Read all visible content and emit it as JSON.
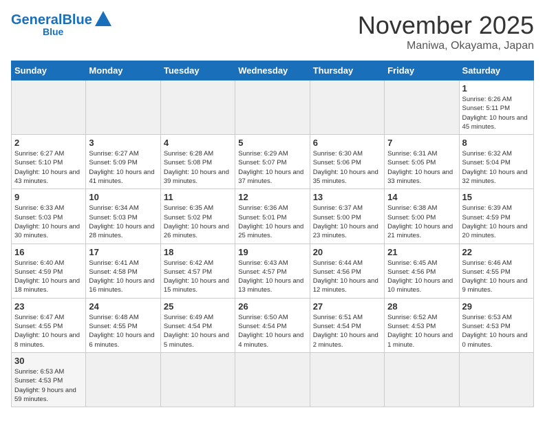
{
  "header": {
    "logo_general": "General",
    "logo_blue": "Blue",
    "month_title": "November 2025",
    "location": "Maniwa, Okayama, Japan"
  },
  "days_of_week": [
    "Sunday",
    "Monday",
    "Tuesday",
    "Wednesday",
    "Thursday",
    "Friday",
    "Saturday"
  ],
  "weeks": [
    [
      {
        "day": "",
        "info": "",
        "empty": true
      },
      {
        "day": "",
        "info": "",
        "empty": true
      },
      {
        "day": "",
        "info": "",
        "empty": true
      },
      {
        "day": "",
        "info": "",
        "empty": true
      },
      {
        "day": "",
        "info": "",
        "empty": true
      },
      {
        "day": "",
        "info": "",
        "empty": true
      },
      {
        "day": "1",
        "info": "Sunrise: 6:26 AM\nSunset: 5:11 PM\nDaylight: 10 hours and 45 minutes."
      }
    ],
    [
      {
        "day": "2",
        "info": "Sunrise: 6:27 AM\nSunset: 5:10 PM\nDaylight: 10 hours and 43 minutes."
      },
      {
        "day": "3",
        "info": "Sunrise: 6:27 AM\nSunset: 5:09 PM\nDaylight: 10 hours and 41 minutes."
      },
      {
        "day": "4",
        "info": "Sunrise: 6:28 AM\nSunset: 5:08 PM\nDaylight: 10 hours and 39 minutes."
      },
      {
        "day": "5",
        "info": "Sunrise: 6:29 AM\nSunset: 5:07 PM\nDaylight: 10 hours and 37 minutes."
      },
      {
        "day": "6",
        "info": "Sunrise: 6:30 AM\nSunset: 5:06 PM\nDaylight: 10 hours and 35 minutes."
      },
      {
        "day": "7",
        "info": "Sunrise: 6:31 AM\nSunset: 5:05 PM\nDaylight: 10 hours and 33 minutes."
      },
      {
        "day": "8",
        "info": "Sunrise: 6:32 AM\nSunset: 5:04 PM\nDaylight: 10 hours and 32 minutes."
      }
    ],
    [
      {
        "day": "9",
        "info": "Sunrise: 6:33 AM\nSunset: 5:03 PM\nDaylight: 10 hours and 30 minutes."
      },
      {
        "day": "10",
        "info": "Sunrise: 6:34 AM\nSunset: 5:03 PM\nDaylight: 10 hours and 28 minutes."
      },
      {
        "day": "11",
        "info": "Sunrise: 6:35 AM\nSunset: 5:02 PM\nDaylight: 10 hours and 26 minutes."
      },
      {
        "day": "12",
        "info": "Sunrise: 6:36 AM\nSunset: 5:01 PM\nDaylight: 10 hours and 25 minutes."
      },
      {
        "day": "13",
        "info": "Sunrise: 6:37 AM\nSunset: 5:00 PM\nDaylight: 10 hours and 23 minutes."
      },
      {
        "day": "14",
        "info": "Sunrise: 6:38 AM\nSunset: 5:00 PM\nDaylight: 10 hours and 21 minutes."
      },
      {
        "day": "15",
        "info": "Sunrise: 6:39 AM\nSunset: 4:59 PM\nDaylight: 10 hours and 20 minutes."
      }
    ],
    [
      {
        "day": "16",
        "info": "Sunrise: 6:40 AM\nSunset: 4:59 PM\nDaylight: 10 hours and 18 minutes."
      },
      {
        "day": "17",
        "info": "Sunrise: 6:41 AM\nSunset: 4:58 PM\nDaylight: 10 hours and 16 minutes."
      },
      {
        "day": "18",
        "info": "Sunrise: 6:42 AM\nSunset: 4:57 PM\nDaylight: 10 hours and 15 minutes."
      },
      {
        "day": "19",
        "info": "Sunrise: 6:43 AM\nSunset: 4:57 PM\nDaylight: 10 hours and 13 minutes."
      },
      {
        "day": "20",
        "info": "Sunrise: 6:44 AM\nSunset: 4:56 PM\nDaylight: 10 hours and 12 minutes."
      },
      {
        "day": "21",
        "info": "Sunrise: 6:45 AM\nSunset: 4:56 PM\nDaylight: 10 hours and 10 minutes."
      },
      {
        "day": "22",
        "info": "Sunrise: 6:46 AM\nSunset: 4:55 PM\nDaylight: 10 hours and 9 minutes."
      }
    ],
    [
      {
        "day": "23",
        "info": "Sunrise: 6:47 AM\nSunset: 4:55 PM\nDaylight: 10 hours and 8 minutes."
      },
      {
        "day": "24",
        "info": "Sunrise: 6:48 AM\nSunset: 4:55 PM\nDaylight: 10 hours and 6 minutes."
      },
      {
        "day": "25",
        "info": "Sunrise: 6:49 AM\nSunset: 4:54 PM\nDaylight: 10 hours and 5 minutes."
      },
      {
        "day": "26",
        "info": "Sunrise: 6:50 AM\nSunset: 4:54 PM\nDaylight: 10 hours and 4 minutes."
      },
      {
        "day": "27",
        "info": "Sunrise: 6:51 AM\nSunset: 4:54 PM\nDaylight: 10 hours and 2 minutes."
      },
      {
        "day": "28",
        "info": "Sunrise: 6:52 AM\nSunset: 4:53 PM\nDaylight: 10 hours and 1 minute."
      },
      {
        "day": "29",
        "info": "Sunrise: 6:53 AM\nSunset: 4:53 PM\nDaylight: 10 hours and 0 minutes."
      }
    ],
    [
      {
        "day": "30",
        "info": "Sunrise: 6:53 AM\nSunset: 4:53 PM\nDaylight: 9 hours and 59 minutes."
      },
      {
        "day": "",
        "info": "",
        "empty": true
      },
      {
        "day": "",
        "info": "",
        "empty": true
      },
      {
        "day": "",
        "info": "",
        "empty": true
      },
      {
        "day": "",
        "info": "",
        "empty": true
      },
      {
        "day": "",
        "info": "",
        "empty": true
      },
      {
        "day": "",
        "info": "",
        "empty": true
      }
    ]
  ]
}
